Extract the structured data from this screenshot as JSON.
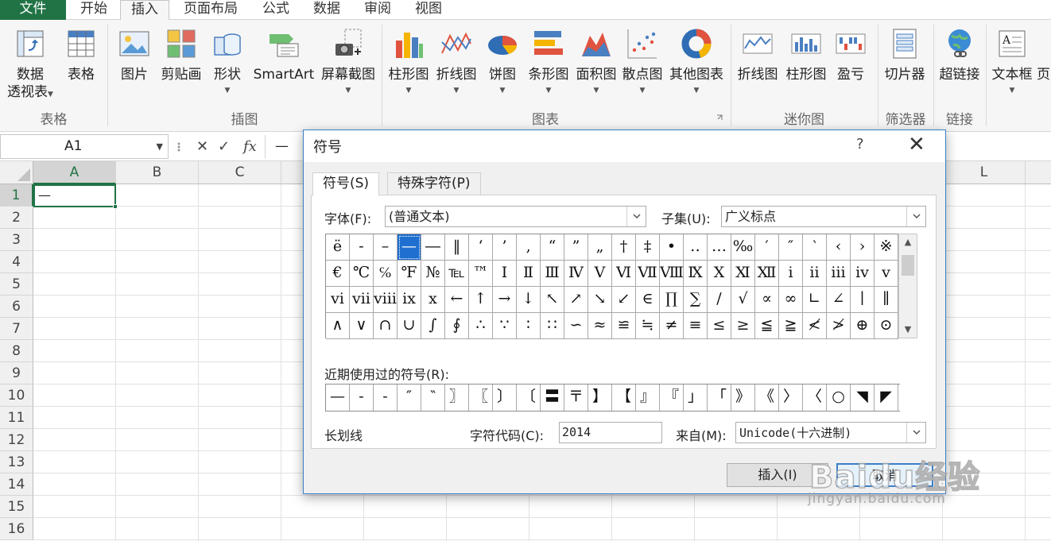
{
  "ribbon": {
    "tabs": [
      "文件",
      "开始",
      "插入",
      "页面布局",
      "公式",
      "数据",
      "审阅",
      "视图"
    ],
    "active_tab": "插入",
    "buttons": {
      "pivot_l1": "数据",
      "pivot_l2": "透视表",
      "table": "表格",
      "picture": "图片",
      "clipart": "剪贴画",
      "shapes": "形状",
      "smartart": "SmartArt",
      "screenshot": "屏幕截图",
      "column": "柱形图",
      "line": "折线图",
      "pie": "饼图",
      "bar": "条形图",
      "area": "面积图",
      "scatter": "散点图",
      "other": "其他图表",
      "spark_line": "折线图",
      "spark_column": "柱形图",
      "spark_winloss": "盈亏",
      "slicer": "切片器",
      "hyperlink": "超链接",
      "textbox": "文本框",
      "page_partial": "页"
    },
    "groups": {
      "tables": "表格",
      "illustrations": "插图",
      "charts": "图表",
      "sparklines": "迷你图",
      "filter": "筛选器",
      "links": "链接"
    },
    "dropdown_glyph": "▼"
  },
  "formula_bar": {
    "name_box": "A1",
    "dropdown": "▼",
    "cancel": "✕",
    "enter": "✓",
    "fx": "fx",
    "content": "—"
  },
  "sheet": {
    "columns": [
      "A",
      "B",
      "C",
      "L"
    ],
    "rows": [
      "1",
      "2",
      "3",
      "4",
      "5",
      "6",
      "7",
      "8",
      "9",
      "10",
      "11",
      "12",
      "13",
      "14",
      "15",
      "16"
    ],
    "cell_a1": "—"
  },
  "dialog": {
    "title": "符号",
    "help": "?",
    "close": "✕",
    "tabs": [
      "符号(S)",
      "特殊字符(P)"
    ],
    "font_label": "字体(F):",
    "font_value": "(普通文本)",
    "subset_label": "子集(U):",
    "subset_value": "广义标点",
    "symbols": [
      [
        "ë",
        "-",
        "–",
        "—",
        "―",
        "‖",
        "‘",
        "’",
        "‚",
        "“",
        "”",
        "„",
        "†",
        "‡",
        "•",
        "‥",
        "…",
        "‰",
        "′",
        "″",
        "‵",
        "‹",
        "›",
        "※"
      ],
      [
        "€",
        "℃",
        "℅",
        "℉",
        "№",
        "℡",
        "™",
        "Ⅰ",
        "Ⅱ",
        "Ⅲ",
        "Ⅳ",
        "Ⅴ",
        "Ⅵ",
        "Ⅶ",
        "Ⅷ",
        "Ⅸ",
        "Ⅹ",
        "Ⅺ",
        "Ⅻ",
        "ⅰ",
        "ⅱ",
        "ⅲ",
        "ⅳ",
        "ⅴ"
      ],
      [
        "ⅵ",
        "ⅶ",
        "ⅷ",
        "ⅸ",
        "ⅹ",
        "←",
        "↑",
        "→",
        "↓",
        "↖",
        "↗",
        "↘",
        "↙",
        "∈",
        "∏",
        "∑",
        "∕",
        "√",
        "∝",
        "∞",
        "∟",
        "∠",
        "∣",
        "∥"
      ],
      [
        "∧",
        "∨",
        "∩",
        "∪",
        "∫",
        "∮",
        "∴",
        "∵",
        "∶",
        "∷",
        "∽",
        "≈",
        "≌",
        "≒",
        "≠",
        "≡",
        "≤",
        "≥",
        "≦",
        "≧",
        "≮",
        "≯",
        "⊕",
        "⊙"
      ]
    ],
    "selected_symbol": "—",
    "recent_label": "近期使用过的符号(R):",
    "recent": [
      "—",
      "-",
      "-",
      "″",
      "‶",
      "〗",
      "〖",
      "〕",
      "〔",
      "〓",
      "〒",
      "】",
      "【",
      "』",
      "『",
      "」",
      "「",
      "》",
      "《",
      "〉",
      "〈",
      "○",
      "◥",
      "◤"
    ],
    "char_name": "长划线",
    "code_label": "字符代码(C):",
    "code_value": "2014",
    "from_label": "来自(M):",
    "from_value": "Unicode(十六进制)",
    "insert_button": "插入(I)",
    "cancel_button": "取消",
    "scroll_up": "▲",
    "scroll_down": "▼",
    "resize_grip": "⋰"
  },
  "watermark": {
    "big": "Baidu经验",
    "small": "jingyan.baidu.com"
  }
}
